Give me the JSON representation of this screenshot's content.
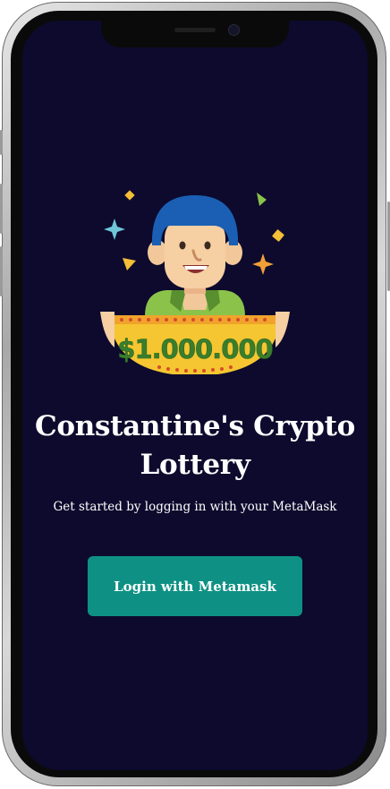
{
  "app": {
    "title": "Constantine's Crypto Lottery",
    "subtitle": "Get started by logging in with your MetaMask"
  },
  "hero": {
    "icon": "lottery-winner-illustration",
    "prize_text": "$1.000.000"
  },
  "login": {
    "label": "Login with Metamask"
  },
  "colors": {
    "background": "#0d0a2d",
    "button": "#0e9184",
    "text": "#ffffff"
  }
}
